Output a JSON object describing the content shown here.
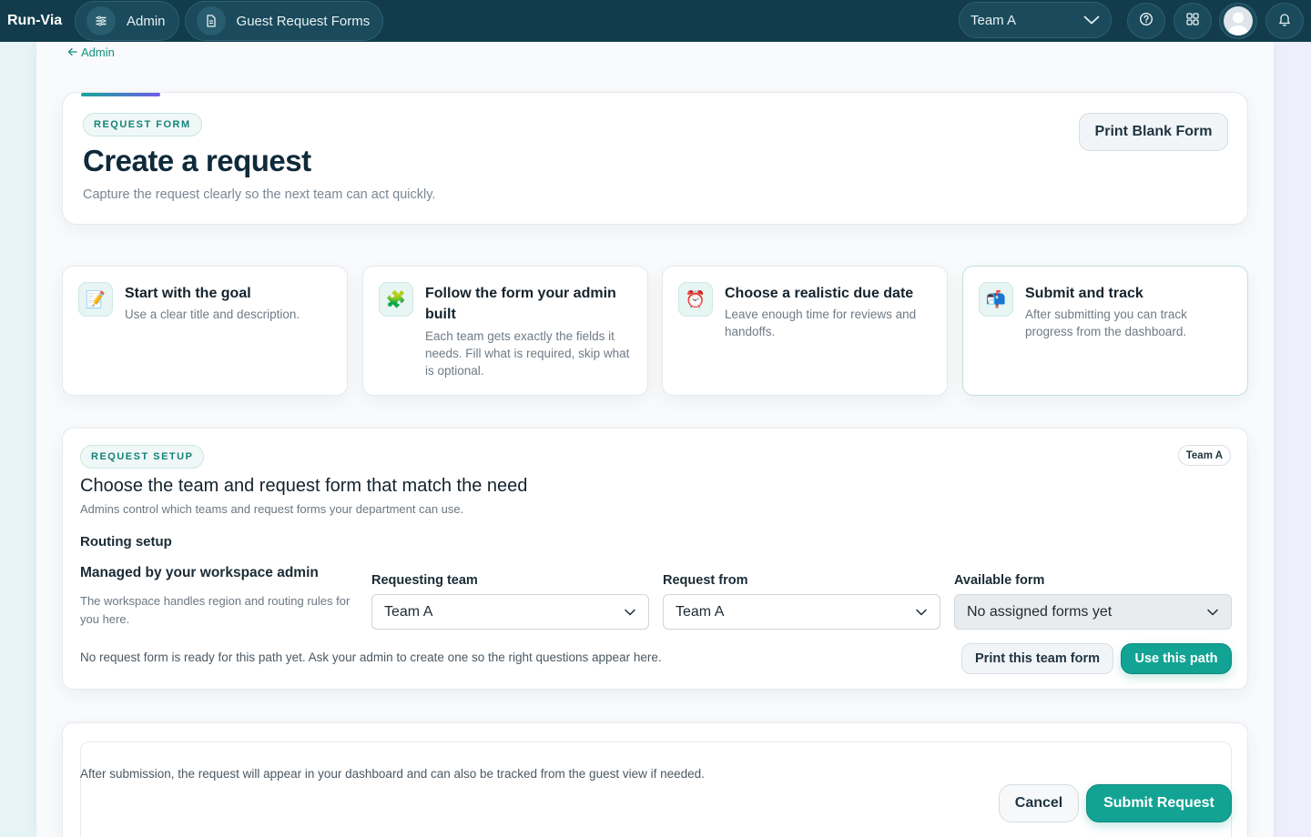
{
  "topbar": {
    "brand": "Run-Via",
    "crumbs": [
      {
        "label": "Admin",
        "icon": "sliders-icon"
      },
      {
        "label": "Guest Request Forms",
        "icon": "document-icon"
      }
    ],
    "team_select": "Team A",
    "icons": [
      "help-icon",
      "apps-grid-icon",
      "avatar",
      "bell-icon"
    ]
  },
  "back_link": "Admin",
  "hero": {
    "badge": "REQUEST FORM",
    "title": "Create a request",
    "subtitle": "Capture the request clearly so the next team can act quickly.",
    "print_button": "Print Blank Form"
  },
  "tips": [
    {
      "icon": "memo-icon",
      "glyph": "📝",
      "title": "Start with the goal",
      "text": "Use a clear title and description."
    },
    {
      "icon": "puzzle-icon",
      "glyph": "🧩",
      "title": "Follow the form your admin built",
      "text": "Each team gets exactly the fields it needs. Fill what is required, skip what is optional."
    },
    {
      "icon": "alarm-clock-icon",
      "glyph": "⏰",
      "title": "Choose a realistic due date",
      "text": "Leave enough time for reviews and handoffs."
    },
    {
      "icon": "mailbox-icon",
      "glyph": "📬",
      "title": "Submit and track",
      "text": "After submitting you can track progress from the dashboard."
    }
  ],
  "setup": {
    "badge": "REQUEST SETUP",
    "team_chip": "Team A",
    "title": "Choose the team and request form that match the need",
    "subtitle": "Admins control which teams and request forms your department can use.",
    "routing_label": "Routing setup",
    "managed_title": "Managed by your workspace admin",
    "managed_text": "The workspace handles region and routing rules for you here.",
    "fields": [
      {
        "label": "Requesting team",
        "value": "Team A"
      },
      {
        "label": "Request from",
        "value": "Team A"
      },
      {
        "label": "Available form",
        "value": "No assigned forms yet"
      }
    ],
    "note": "No request form is ready for this path yet. Ask your admin to create one so the right questions appear here.",
    "print_team_button": "Print this team form",
    "use_path_button": "Use this path"
  },
  "footer": {
    "note": "After submission, the request will appear in your dashboard and can also be tracked from the guest view if needed.",
    "cancel_button": "Cancel",
    "submit_button": "Submit Request"
  },
  "colors": {
    "topbar": "#123c4c",
    "accent": "#13a394",
    "accent_text": "#14907f"
  }
}
